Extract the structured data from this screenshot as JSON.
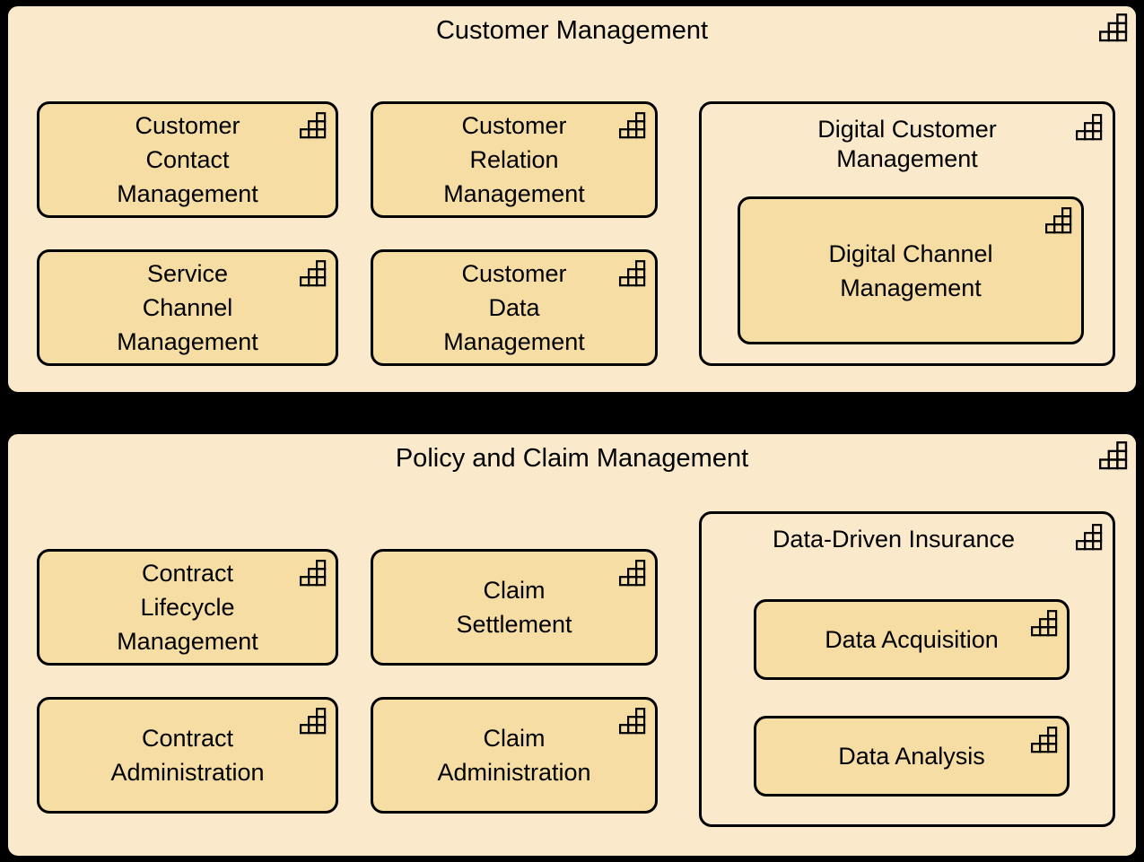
{
  "diagram": {
    "type": "archimate-capability-map",
    "background_color": "#000000",
    "panel_fill": "#fae9ca",
    "capability_fill": "#f6dda3",
    "stroke_color": "#000000",
    "icon_name": "capability-staircase-icon"
  },
  "panels": [
    {
      "id": "customer-management",
      "title": "Customer Management",
      "capabilities": [
        {
          "id": "customer-contact-management",
          "label": "Customer\nContact\nManagement"
        },
        {
          "id": "customer-relation-management",
          "label": "Customer\nRelation\nManagement"
        },
        {
          "id": "service-channel-management",
          "label": "Service\nChannel\nManagement"
        },
        {
          "id": "customer-data-management",
          "label": "Customer\nData\nManagement"
        }
      ],
      "group": {
        "id": "digital-customer-management",
        "title": "Digital Customer\nManagement",
        "capabilities": [
          {
            "id": "digital-channel-management",
            "label": "Digital Channel\nManagement"
          }
        ]
      }
    },
    {
      "id": "policy-and-claim-management",
      "title": "Policy and Claim Management",
      "capabilities": [
        {
          "id": "contract-lifecycle-management",
          "label": "Contract\nLifecycle\nManagement"
        },
        {
          "id": "claim-settlement",
          "label": "Claim\nSettlement"
        },
        {
          "id": "contract-administration",
          "label": "Contract\nAdministration"
        },
        {
          "id": "claim-administration",
          "label": "Claim\nAdministration"
        }
      ],
      "group": {
        "id": "data-driven-insurance",
        "title": "Data-Driven Insurance",
        "capabilities": [
          {
            "id": "data-acquisition",
            "label": "Data Acquisition"
          },
          {
            "id": "data-analysis",
            "label": "Data Analysis"
          }
        ]
      }
    }
  ]
}
